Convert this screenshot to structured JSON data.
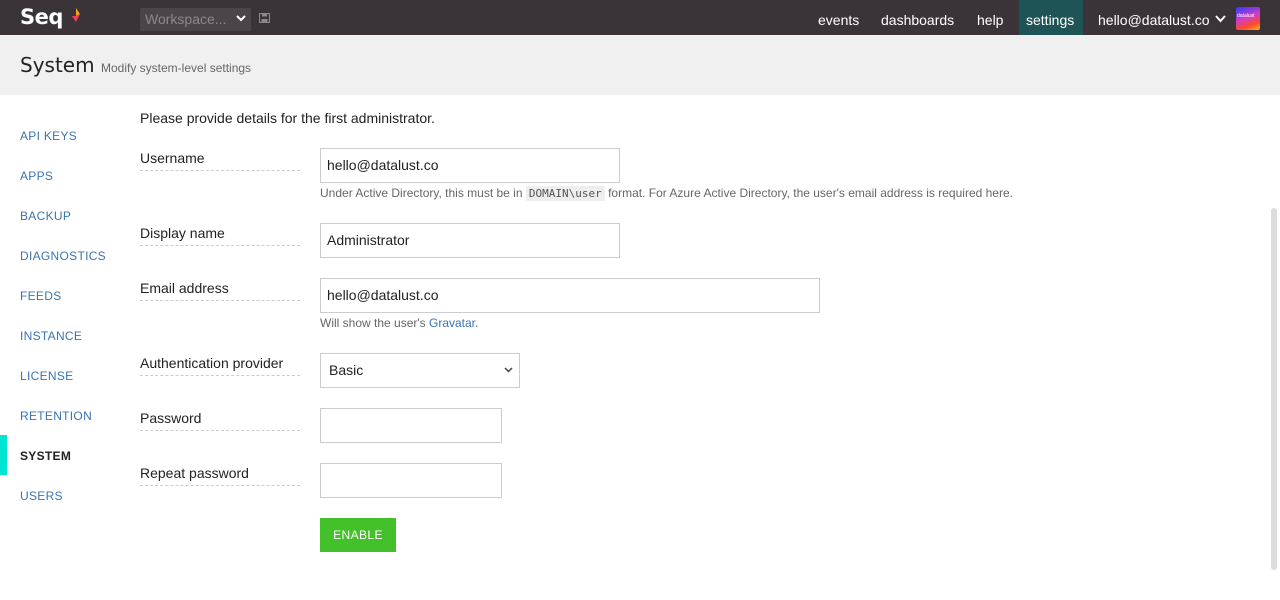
{
  "app": {
    "logo_text": "Seq"
  },
  "topbar": {
    "workspace_label": "Workspace...",
    "nav": [
      "events",
      "dashboards",
      "help",
      "settings"
    ],
    "active_nav": "settings",
    "user": "hello@datalust.co",
    "avatar_text": "datalust"
  },
  "header": {
    "title": "System",
    "subtitle": "Modify system-level settings"
  },
  "sidebar": {
    "items": [
      "API KEYS",
      "APPS",
      "BACKUP",
      "DIAGNOSTICS",
      "FEEDS",
      "INSTANCE",
      "LICENSE",
      "RETENTION",
      "SYSTEM",
      "USERS"
    ],
    "active": "SYSTEM",
    "accent_color": "#00e5d2"
  },
  "form": {
    "intro": "Please provide details for the first administrator.",
    "username": {
      "label": "Username",
      "value": "hello@datalust.co",
      "help_pre": "Under Active Directory, this must be in",
      "help_code": "DOMAIN\\user",
      "help_post": "format. For Azure Active Directory, the user's email address is required here."
    },
    "display_name": {
      "label": "Display name",
      "value": "Administrator"
    },
    "email": {
      "label": "Email address",
      "value": "hello@datalust.co",
      "help_pre": "Will show the user's",
      "help_link": "Gravatar",
      "help_post": "."
    },
    "auth_provider": {
      "label": "Authentication provider",
      "value": "Basic"
    },
    "password": {
      "label": "Password",
      "value": ""
    },
    "repeat_password": {
      "label": "Repeat password",
      "value": ""
    },
    "enable_button": "ENABLE",
    "button_color": "#44c12a"
  }
}
